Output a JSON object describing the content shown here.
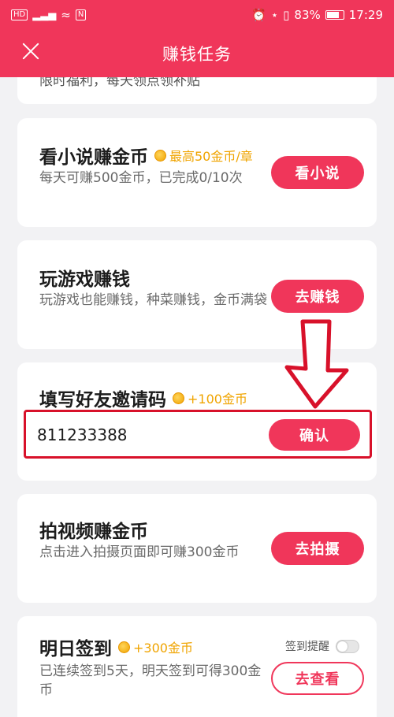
{
  "status_bar": {
    "left_badges": [
      "HD",
      "4G",
      "N"
    ],
    "battery": "83%",
    "time": "17:29"
  },
  "header": {
    "title": "赚钱任务"
  },
  "clipped_card": {
    "text": "限时福利，每天领点领补贴"
  },
  "tasks": {
    "novel": {
      "title": "看小说赚金币",
      "reward": "最高50金币/章",
      "desc": "每天可赚500金币，已完成0/10次",
      "button": "看小说"
    },
    "game": {
      "title": "玩游戏赚钱",
      "desc": "玩游戏也能赚钱，种菜赚钱，金币满袋",
      "button": "去赚钱"
    },
    "invite": {
      "title": "填写好友邀请码",
      "reward": "+100金币",
      "code": "811233388",
      "button": "确认"
    },
    "video": {
      "title": "拍视频赚金币",
      "desc": "点击进入拍摄页面即可赚300金币",
      "button": "去拍摄"
    },
    "checkin": {
      "title": "明日签到",
      "reward": "+300金币",
      "reminder_label": "签到提醒",
      "reminder_on": false,
      "desc": "已连续签到5天，明天签到可得300金币",
      "button": "去查看"
    }
  },
  "colors": {
    "brand": "#f0365a",
    "reward": "#f0a400",
    "highlight": "#d8112a"
  }
}
